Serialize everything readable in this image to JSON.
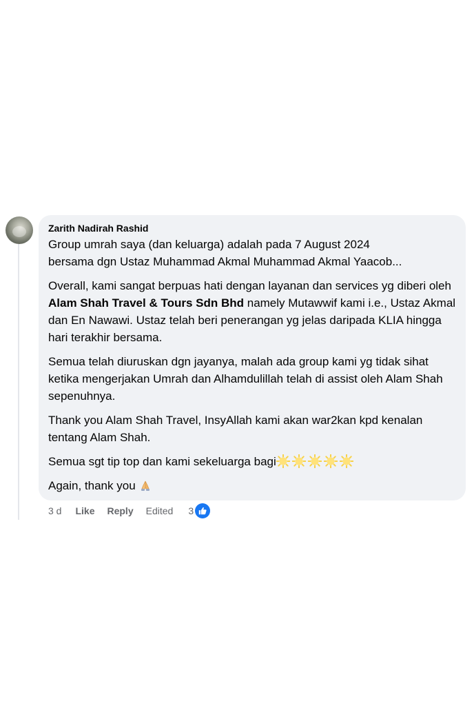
{
  "comment": {
    "author": "Zarith Nadirah Rashid",
    "paragraphs": {
      "p1_line1": "Group umrah saya (dan keluarga) adalah pada 7 August 2024",
      "p1_line2": "bersama dgn Ustaz Muhammad Akmal Muhammad Akmal Yaacob...",
      "p2_before": "Overall, kami sangat berpuas hati dengan layanan dan services yg diberi oleh ",
      "p2_link": "Alam Shah Travel & Tours Sdn Bhd",
      "p2_after": " namely Mutawwif kami i.e., Ustaz Akmal dan En Nawawi. Ustaz telah beri penerangan yg jelas daripada KLIA hingga hari terakhir bersama.",
      "p3": "Semua telah diuruskan dgn jayanya, malah ada group kami yg tidak sihat ketika mengerjakan Umrah dan Alhamdulillah telah di assist oleh Alam Shah sepenuhnya.",
      "p4": "Thank you Alam Shah Travel, InsyAllah kami akan war2kan kpd kenalan tentang Alam Shah.",
      "p5": "Semua sgt tip top dan kami sekeluarga bagi",
      "p6": "Again, thank you"
    },
    "emojis": {
      "star_count": 5,
      "star_icon": "star-emoji-icon",
      "pray_icon": "folded-hands-emoji-icon"
    }
  },
  "actions": {
    "time": "3 d",
    "like": "Like",
    "reply": "Reply",
    "edited": "Edited",
    "reaction_count": "3",
    "reaction_icon": "like-icon"
  },
  "colors": {
    "bubble_bg": "#f0f2f5",
    "meta_text": "#65676b",
    "like_blue": "#1877f2"
  }
}
